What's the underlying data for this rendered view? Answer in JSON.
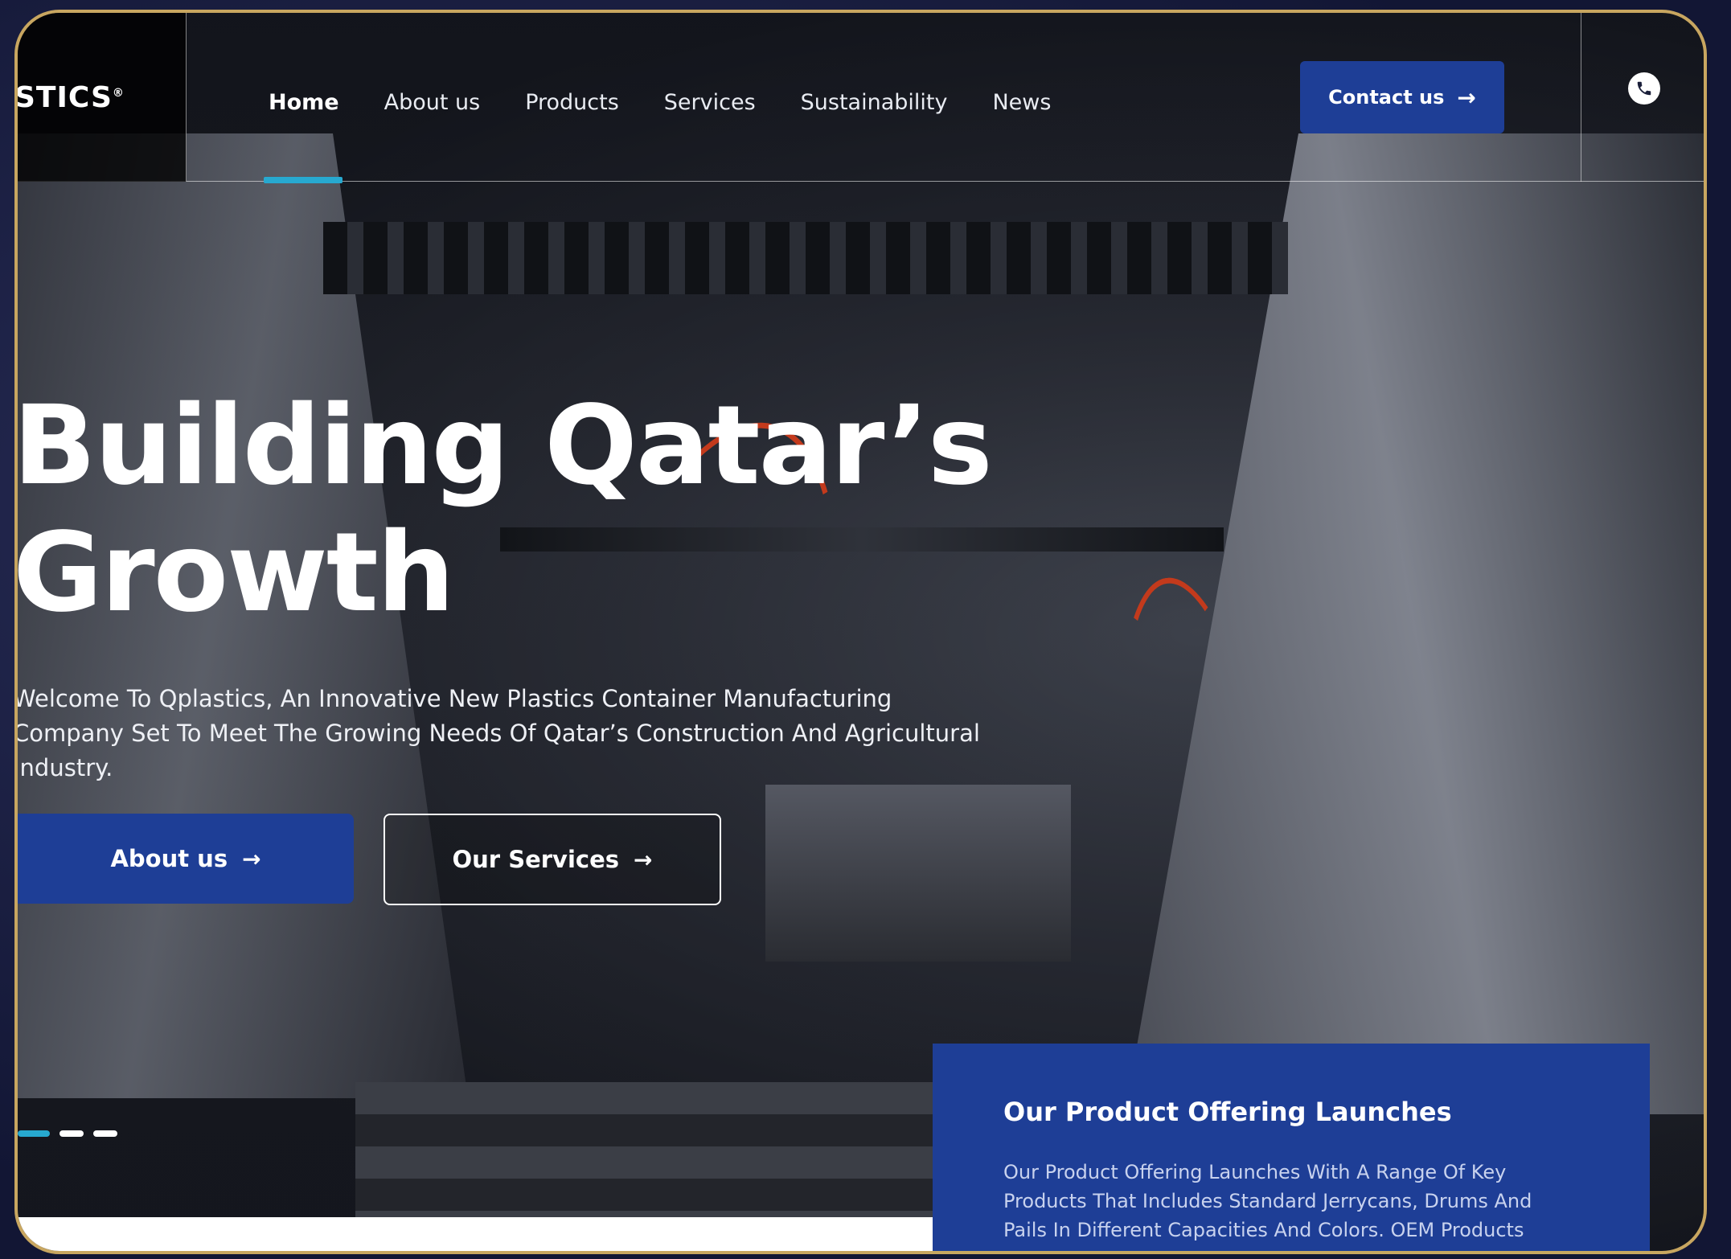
{
  "header": {
    "logo_text": "STICS",
    "logo_mark": "®",
    "nav": [
      {
        "label": "Home",
        "active": true
      },
      {
        "label": "About us"
      },
      {
        "label": "Products"
      },
      {
        "label": "Services"
      },
      {
        "label": "Sustainability"
      },
      {
        "label": "News"
      }
    ],
    "contact_label": "Contact us",
    "phone_icon": "phone-icon"
  },
  "hero": {
    "title_line1": "Building Qatar’s",
    "title_line2": "Growth",
    "description": "Welcome To Qplastics, An Innovative New Plastics Container Manufacturing Company Set To Meet The Growing Needs Of Qatar’s Construction And Agricultural Industry.",
    "about_button": "About us",
    "services_button": "Our Services",
    "slides": 3,
    "active_slide": 1
  },
  "offer": {
    "title": "Our Product Offering Launches",
    "text": "Our Product Offering Launches With A Range Of Key Products That Includes Standard Jerrycans, Drums And Pails In Different Capacities And Colors. OEM Products"
  },
  "colors": {
    "brand_blue": "#1e3e96",
    "accent_cyan": "#27a9d0",
    "frame_gold": "#c8a660"
  }
}
